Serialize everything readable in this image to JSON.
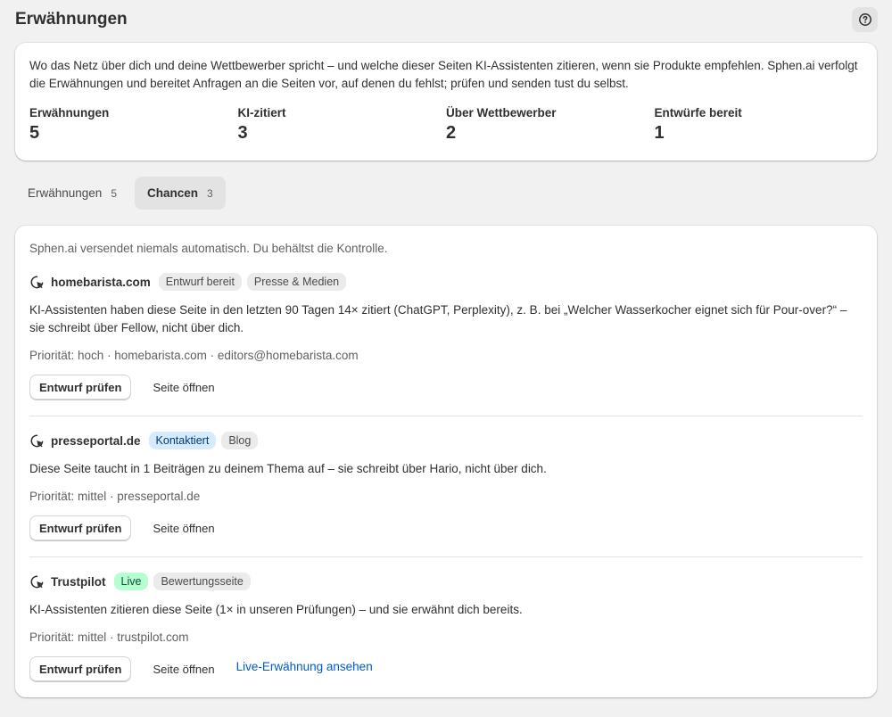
{
  "header": {
    "title": "Erwähnungen",
    "help_icon": "question-circle-icon"
  },
  "summary": {
    "text": "Wo das Netz über dich und deine Wettbewerber spricht – und welche dieser Seiten KI-Assistenten zitieren, wenn sie Produkte empfehlen. Sphen.ai verfolgt die Erwähnungen und bereitet Anfragen an die Seiten vor, auf denen du fehlst; prüfen und senden tust du selbst.",
    "stats": [
      {
        "label": "Erwähnungen",
        "value": "5"
      },
      {
        "label": "KI-zitiert",
        "value": "3"
      },
      {
        "label": "Über Wettbewerber",
        "value": "2"
      },
      {
        "label": "Entwürfe bereit",
        "value": "1"
      }
    ]
  },
  "tabs": [
    {
      "label": "Erwähnungen",
      "count": "5",
      "active": false
    },
    {
      "label": "Chancen",
      "count": "3",
      "active": true
    }
  ],
  "opportunities": {
    "note": "Sphen.ai versendet niemals automatisch. Du behältst die Kontrolle.",
    "items": [
      {
        "name": "homebarista.com",
        "badges": [
          "Entwurf bereit",
          "Presse & Medien"
        ],
        "desc": "KI-Assistenten haben diese Seite in den letzten 90 Tagen 14× zitiert (ChatGPT, Perplexity), z. B. bei „Welcher Wasserkocher eignet sich für Pour-over?“ – sie schreibt über Fellow, nicht über dich.",
        "meta": "Priorität: hoch · homebarista.com · editors@homebarista.com",
        "primary": "Entwurf prüfen",
        "secondary": "Seite öffnen"
      },
      {
        "name": "presseportal.de",
        "badges": [
          "Kontaktiert",
          "Blog"
        ],
        "desc": "Diese Seite taucht in 1 Beiträgen zu deinem Thema auf – sie schreibt über Hario, nicht über dich.",
        "meta": "Priorität: mittel · presseportal.de",
        "primary": "Entwurf prüfen",
        "secondary": "Seite öffnen"
      },
      {
        "name": "Trustpilot",
        "badges": [
          "Live",
          "Bewertungsseite"
        ],
        "desc": "KI-Assistenten zitieren diese Seite (1× in unseren Prüfungen) – und sie erwähnt dich bereits.",
        "meta": "Priorität: mittel · trustpilot.com",
        "primary": "Entwurf prüfen",
        "secondary": "Seite öffnen",
        "link": "Live-Erwähnung ansehen"
      }
    ]
  },
  "colors": {
    "background": "#f1f1f1",
    "link": "#005bd3",
    "badge_blue": "#d6ebff",
    "badge_green": "#b4fed2"
  }
}
